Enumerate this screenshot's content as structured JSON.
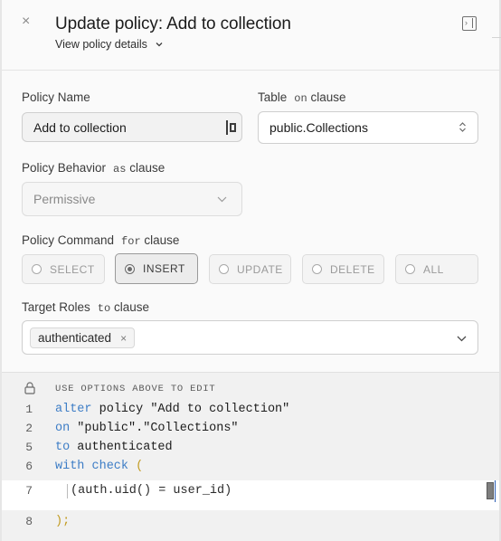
{
  "header": {
    "close_glyph": "×",
    "title": "Update policy: Add to collection",
    "subtitle": "View policy details"
  },
  "form": {
    "policy_name": {
      "label": "Policy Name",
      "value": "Add to collection"
    },
    "table": {
      "label": "Table",
      "sub": "on",
      "sub_word": "clause",
      "value": "public.Collections"
    },
    "behavior": {
      "label": "Policy Behavior",
      "sub": "as",
      "sub_word": "clause",
      "value": "Permissive"
    },
    "command": {
      "label": "Policy Command",
      "sub": "for",
      "sub_word": "clause",
      "options": [
        "SELECT",
        "INSERT",
        "UPDATE",
        "DELETE",
        "ALL"
      ],
      "selected": "INSERT"
    },
    "roles": {
      "label": "Target Roles",
      "sub": "to",
      "sub_word": "clause",
      "chip": "authenticated",
      "chip_remove": "×"
    }
  },
  "editor": {
    "note": "USE OPTIONS ABOVE TO EDIT",
    "lines": [
      {
        "num": "1",
        "kw": "alter",
        "rest": " policy \"Add to collection\""
      },
      {
        "num": "2",
        "kw": "on",
        "rest": " \"public\".\"Collections\""
      },
      {
        "num": "5",
        "kw": "to",
        "rest": " authenticated"
      },
      {
        "num": "6",
        "kw": "with check",
        "rest": " ("
      },
      {
        "num": "7",
        "text": "(auth.uid() = user_id)"
      },
      {
        "num": "8",
        "text": ");"
      }
    ]
  },
  "icons": {
    "close": "close-icon",
    "chevron": "chevron-down-icon",
    "collapse": "panel-collapse-icon",
    "password_manager": "password-manager-icon",
    "updown": "select-updown-icon",
    "lock": "lock-icon"
  },
  "colors": {
    "keyword": "#3d7dc6",
    "paren": "#c29b20",
    "panel_bg": "#fafafa",
    "editor_bg": "#f1f1f1"
  }
}
